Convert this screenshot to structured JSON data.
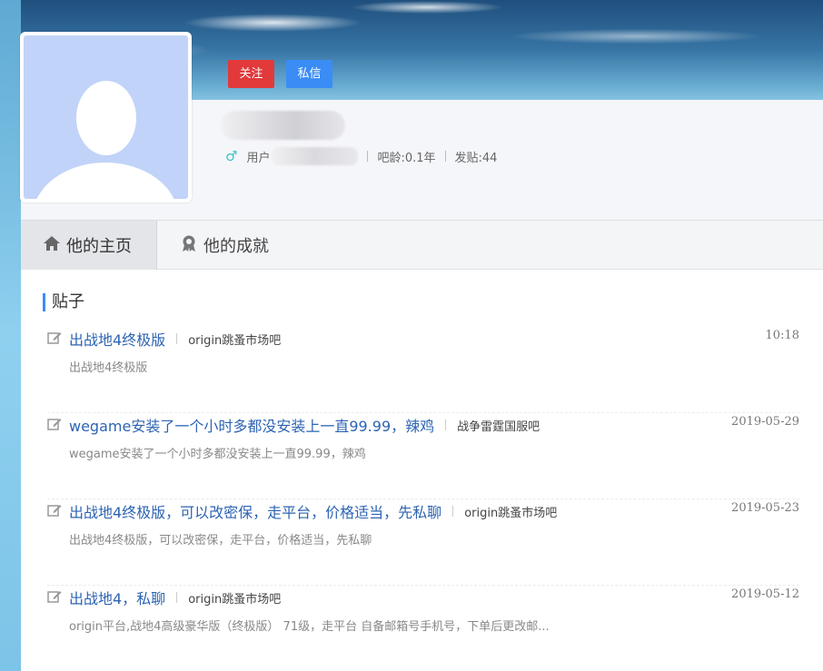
{
  "actions": {
    "follow_label": "关注",
    "message_label": "私信"
  },
  "profile": {
    "user_prefix": "用户",
    "bar_age": "吧龄:0.1年",
    "post_count": "发贴:44"
  },
  "tabs": [
    {
      "label": "他的主页",
      "icon": "home-icon"
    },
    {
      "label": "他的成就",
      "icon": "badge-icon"
    }
  ],
  "section": {
    "title": "贴子"
  },
  "posts": [
    {
      "title": "出战地4终极版",
      "forum": "origin跳蚤市场吧",
      "time": "10:18",
      "desc": "出战地4终极版"
    },
    {
      "title": "wegame安装了一个小时多都没安装上一直99.99，辣鸡",
      "forum": "战争雷霆国服吧",
      "time": "2019-05-29",
      "desc": "wegame安装了一个小时多都没安装上一直99.99，辣鸡"
    },
    {
      "title": "出战地4终极版，可以改密保，走平台，价格适当，先私聊",
      "forum": "origin跳蚤市场吧",
      "time": "2019-05-23",
      "desc": "出战地4终极版，可以改密保，走平台，价格适当，先私聊"
    },
    {
      "title": "出战地4，私聊",
      "forum": "origin跳蚤市场吧",
      "time": "2019-05-12",
      "desc": "origin平台,战地4高级豪华版（终极版） 71级，走平台 自备邮箱号手机号，下单后更改邮..."
    }
  ],
  "colors": {
    "accent_blue": "#3b8cf5",
    "follow_red": "#e2393b",
    "link_blue": "#2d64b3"
  }
}
